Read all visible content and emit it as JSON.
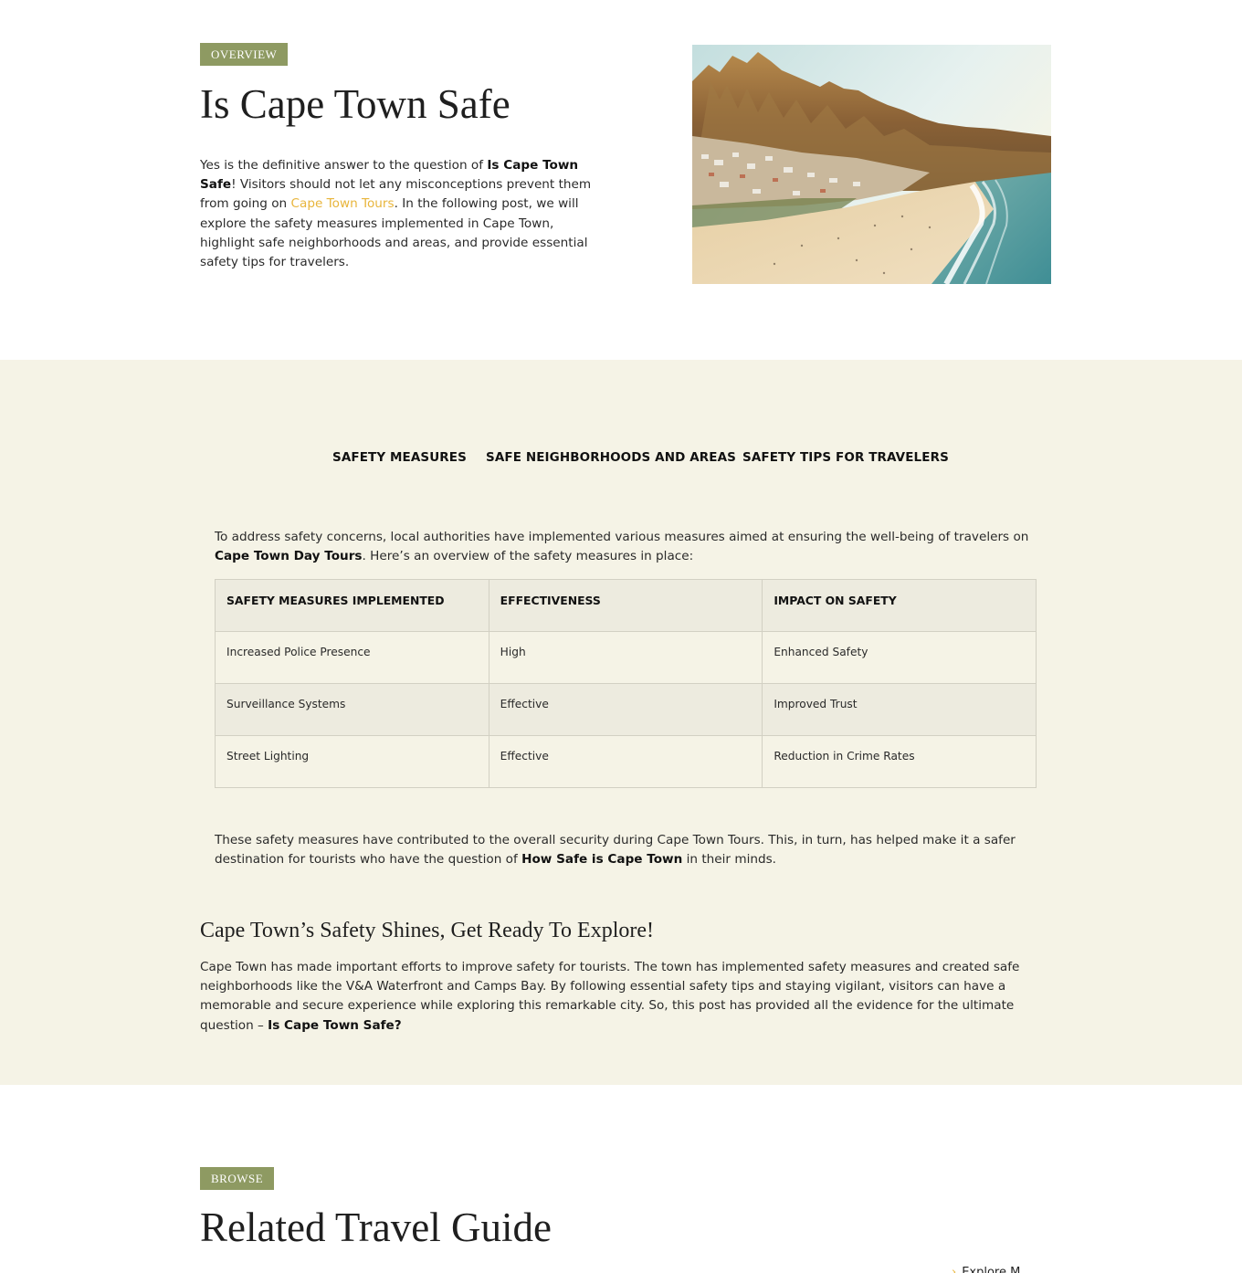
{
  "overview": {
    "tag": "OVERVIEW",
    "title": "Is Cape Town Safe",
    "intro": {
      "t1": "Yes is the definitive answer to the question of ",
      "b1": "Is Cape Town Safe",
      "t2": "! Visitors should not let any misconceptions prevent them from going on ",
      "link": "Cape Town Tours",
      "t3": ". In the following post, we will explore the safety measures implemented in Cape Town, highlight safe neighborhoods and areas, and provide essential safety tips for travelers."
    }
  },
  "tabs": [
    "SAFETY MEASURES",
    "SAFE NEIGHBORHOODS AND AREAS",
    "SAFETY TIPS FOR TRAVELERS"
  ],
  "safety": {
    "intro": {
      "t1": "To address safety concerns, local authorities have implemented various measures aimed at ensuring the well-being of travelers on ",
      "b1": "Cape Town Day Tours",
      "t2": ". Here’s an overview of the safety measures in place:"
    },
    "table": {
      "headers": [
        "SAFETY MEASURES IMPLEMENTED",
        "EFFECTIVENESS",
        "IMPACT ON SAFETY"
      ],
      "rows": [
        [
          "Increased Police Presence",
          "High",
          "Enhanced Safety"
        ],
        [
          "Surveillance Systems",
          "Effective",
          "Improved Trust"
        ],
        [
          "Street Lighting",
          "Effective",
          "Reduction in Crime Rates"
        ]
      ]
    },
    "after": {
      "t1": "These safety measures have contributed to the overall security during Cape Town Tours. This, in turn, has helped make it a safer destination for tourists who have the question of ",
      "b1": "How Safe is Cape Town",
      "t2": " in their minds."
    }
  },
  "conclusion": {
    "title": "Cape Town’s Safety Shines, Get Ready To Explore!",
    "t1": "Cape Town has made important efforts to improve safety for tourists. The town has implemented safety measures and created safe neighborhoods like the V&A Waterfront and Camps Bay. By following essential safety tips and staying vigilant, visitors can have a memorable and secure experience while exploring this remarkable city. So, this post has provided all the evidence for the ultimate question – ",
    "b1": "Is Cape Town Safe?"
  },
  "browse": {
    "tag": "BROWSE",
    "title": "Related Travel Guide",
    "explore_label": "Explore M",
    "explore_icon": "arrow-right-icon"
  },
  "colors": {
    "accent_olive": "#8e9a62",
    "link_gold": "#e8b53b",
    "beige_bg": "#f5f3e6",
    "table_alt_bg": "#edebdf"
  }
}
